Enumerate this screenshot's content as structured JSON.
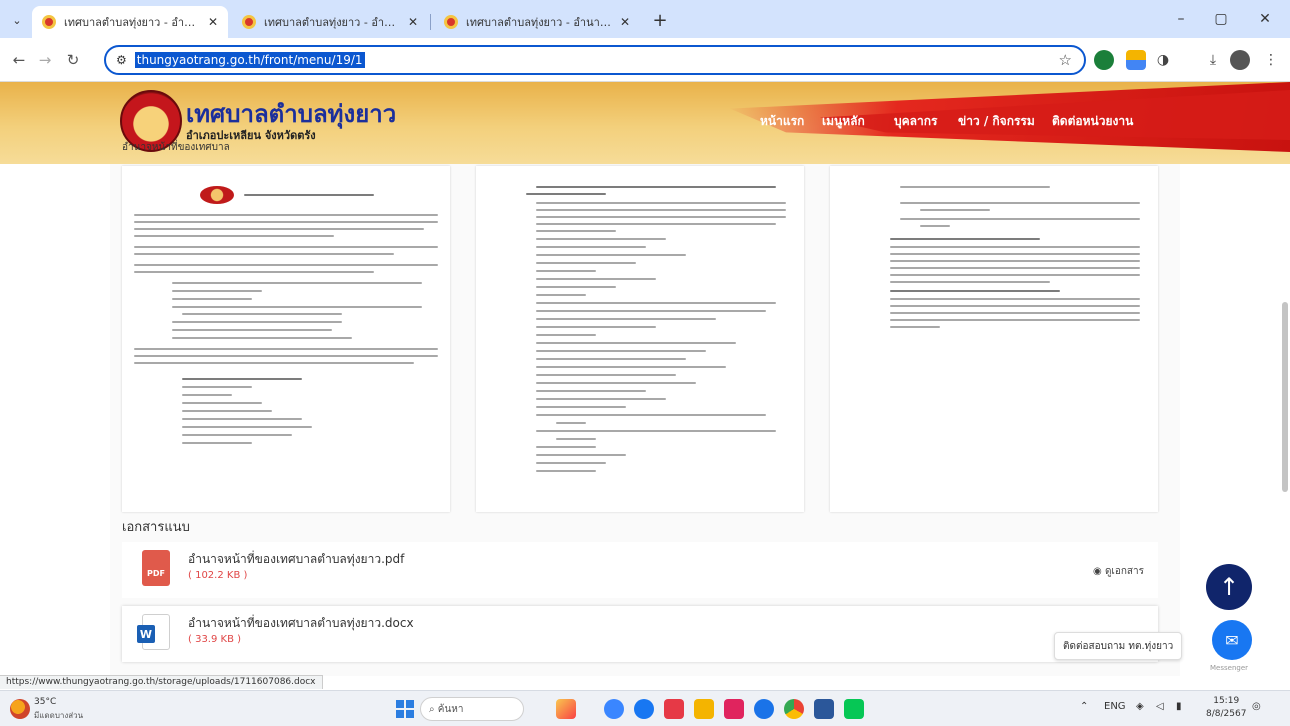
{
  "browser": {
    "tabs": [
      {
        "title": "เทศบาลตำบลทุ่งยาว - อำนาจหน้าที่",
        "active": true
      },
      {
        "title": "เทศบาลตำบลทุ่งยาว - อำนาจหน้าที่",
        "active": false
      },
      {
        "title": "เทศบาลตำบลทุ่งยาว - อำนาจหน้าที่",
        "active": false
      }
    ],
    "new_tab": "+",
    "url": "thungyaotrang.go.th/front/menu/19/1",
    "window_buttons": {
      "minimize": "–",
      "maximize": "▢",
      "close": "✕"
    }
  },
  "site": {
    "title": "เทศบาลตำบลทุ่งยาว",
    "subtitle": "อำเภอปะเหลียน จังหวัดตรัง",
    "subtitle2": "อำนาจหน้าที่ของเทศบาล",
    "nav": [
      "หน้าแรก",
      "เมนูหลัก",
      "บุคลากร",
      "ข่าว / กิจกรรม",
      "ติดต่อหน่วยงาน"
    ]
  },
  "attachments": {
    "heading": "เอกสารแนบ",
    "files": [
      {
        "name": "อำนาจหน้าที่ของเทศบาลตำบลทุ่งยาว.pdf",
        "size": "( 102.2 KB )",
        "type": "PDF",
        "action": "ดูเอกสาร"
      },
      {
        "name": "อำนาจหน้าที่ของเทศบาลตำบลทุ่งยาว.docx",
        "size": "( 33.9 KB )",
        "type": "W",
        "action": ""
      }
    ]
  },
  "widgets": {
    "scroll_top": "↑",
    "chat_prompt": "ติดต่อสอบถาม ทต.ทุ่งยาว",
    "messenger_label": "Messenger"
  },
  "status_bar_url": "https://www.thungyaotrang.go.th/storage/uploads/1711607086.docx",
  "taskbar": {
    "weather_temp": "35°C",
    "weather_status": "มีแดดบางส่วน",
    "search_placeholder": "ค้นหา",
    "tray_lang": "ENG",
    "time": "15:19",
    "date": "8/8/2567"
  },
  "colors": {
    "accent": "#0b57d0",
    "header_gold": "#f3d07c",
    "header_red": "#d61c17",
    "title_blue": "#1b2f9c",
    "file_size_red": "#e04646",
    "scroll_top_bg": "#10256b",
    "messenger_blue": "#1877f2"
  }
}
